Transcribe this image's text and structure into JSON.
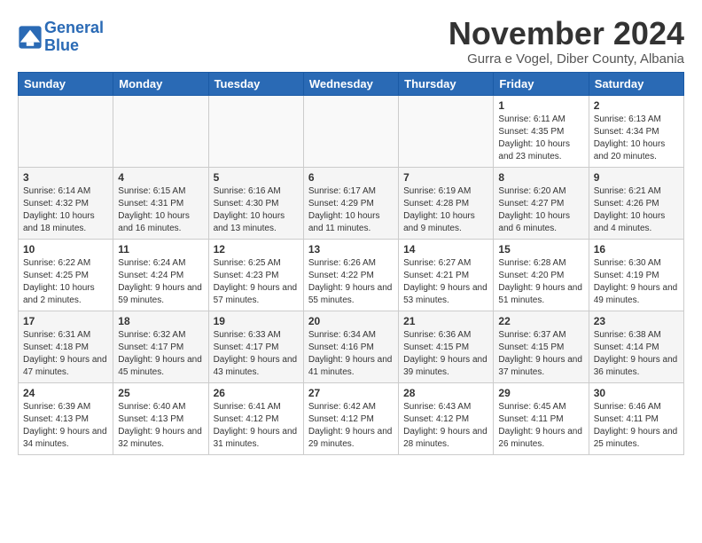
{
  "logo": {
    "line1": "General",
    "line2": "Blue"
  },
  "header": {
    "month": "November 2024",
    "location": "Gurra e Vogel, Diber County, Albania"
  },
  "weekdays": [
    "Sunday",
    "Monday",
    "Tuesday",
    "Wednesday",
    "Thursday",
    "Friday",
    "Saturday"
  ],
  "weeks": [
    [
      {
        "day": "",
        "info": ""
      },
      {
        "day": "",
        "info": ""
      },
      {
        "day": "",
        "info": ""
      },
      {
        "day": "",
        "info": ""
      },
      {
        "day": "",
        "info": ""
      },
      {
        "day": "1",
        "info": "Sunrise: 6:11 AM\nSunset: 4:35 PM\nDaylight: 10 hours and 23 minutes."
      },
      {
        "day": "2",
        "info": "Sunrise: 6:13 AM\nSunset: 4:34 PM\nDaylight: 10 hours and 20 minutes."
      }
    ],
    [
      {
        "day": "3",
        "info": "Sunrise: 6:14 AM\nSunset: 4:32 PM\nDaylight: 10 hours and 18 minutes."
      },
      {
        "day": "4",
        "info": "Sunrise: 6:15 AM\nSunset: 4:31 PM\nDaylight: 10 hours and 16 minutes."
      },
      {
        "day": "5",
        "info": "Sunrise: 6:16 AM\nSunset: 4:30 PM\nDaylight: 10 hours and 13 minutes."
      },
      {
        "day": "6",
        "info": "Sunrise: 6:17 AM\nSunset: 4:29 PM\nDaylight: 10 hours and 11 minutes."
      },
      {
        "day": "7",
        "info": "Sunrise: 6:19 AM\nSunset: 4:28 PM\nDaylight: 10 hours and 9 minutes."
      },
      {
        "day": "8",
        "info": "Sunrise: 6:20 AM\nSunset: 4:27 PM\nDaylight: 10 hours and 6 minutes."
      },
      {
        "day": "9",
        "info": "Sunrise: 6:21 AM\nSunset: 4:26 PM\nDaylight: 10 hours and 4 minutes."
      }
    ],
    [
      {
        "day": "10",
        "info": "Sunrise: 6:22 AM\nSunset: 4:25 PM\nDaylight: 10 hours and 2 minutes."
      },
      {
        "day": "11",
        "info": "Sunrise: 6:24 AM\nSunset: 4:24 PM\nDaylight: 9 hours and 59 minutes."
      },
      {
        "day": "12",
        "info": "Sunrise: 6:25 AM\nSunset: 4:23 PM\nDaylight: 9 hours and 57 minutes."
      },
      {
        "day": "13",
        "info": "Sunrise: 6:26 AM\nSunset: 4:22 PM\nDaylight: 9 hours and 55 minutes."
      },
      {
        "day": "14",
        "info": "Sunrise: 6:27 AM\nSunset: 4:21 PM\nDaylight: 9 hours and 53 minutes."
      },
      {
        "day": "15",
        "info": "Sunrise: 6:28 AM\nSunset: 4:20 PM\nDaylight: 9 hours and 51 minutes."
      },
      {
        "day": "16",
        "info": "Sunrise: 6:30 AM\nSunset: 4:19 PM\nDaylight: 9 hours and 49 minutes."
      }
    ],
    [
      {
        "day": "17",
        "info": "Sunrise: 6:31 AM\nSunset: 4:18 PM\nDaylight: 9 hours and 47 minutes."
      },
      {
        "day": "18",
        "info": "Sunrise: 6:32 AM\nSunset: 4:17 PM\nDaylight: 9 hours and 45 minutes."
      },
      {
        "day": "19",
        "info": "Sunrise: 6:33 AM\nSunset: 4:17 PM\nDaylight: 9 hours and 43 minutes."
      },
      {
        "day": "20",
        "info": "Sunrise: 6:34 AM\nSunset: 4:16 PM\nDaylight: 9 hours and 41 minutes."
      },
      {
        "day": "21",
        "info": "Sunrise: 6:36 AM\nSunset: 4:15 PM\nDaylight: 9 hours and 39 minutes."
      },
      {
        "day": "22",
        "info": "Sunrise: 6:37 AM\nSunset: 4:15 PM\nDaylight: 9 hours and 37 minutes."
      },
      {
        "day": "23",
        "info": "Sunrise: 6:38 AM\nSunset: 4:14 PM\nDaylight: 9 hours and 36 minutes."
      }
    ],
    [
      {
        "day": "24",
        "info": "Sunrise: 6:39 AM\nSunset: 4:13 PM\nDaylight: 9 hours and 34 minutes."
      },
      {
        "day": "25",
        "info": "Sunrise: 6:40 AM\nSunset: 4:13 PM\nDaylight: 9 hours and 32 minutes."
      },
      {
        "day": "26",
        "info": "Sunrise: 6:41 AM\nSunset: 4:12 PM\nDaylight: 9 hours and 31 minutes."
      },
      {
        "day": "27",
        "info": "Sunrise: 6:42 AM\nSunset: 4:12 PM\nDaylight: 9 hours and 29 minutes."
      },
      {
        "day": "28",
        "info": "Sunrise: 6:43 AM\nSunset: 4:12 PM\nDaylight: 9 hours and 28 minutes."
      },
      {
        "day": "29",
        "info": "Sunrise: 6:45 AM\nSunset: 4:11 PM\nDaylight: 9 hours and 26 minutes."
      },
      {
        "day": "30",
        "info": "Sunrise: 6:46 AM\nSunset: 4:11 PM\nDaylight: 9 hours and 25 minutes."
      }
    ]
  ]
}
